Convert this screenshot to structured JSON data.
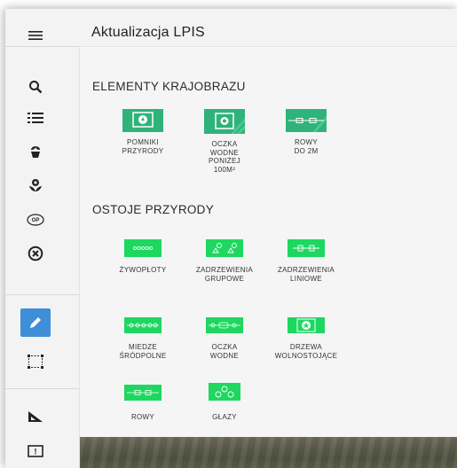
{
  "header": {
    "title": "Aktualizacja LPIS"
  },
  "sidebar": {
    "items": [
      {
        "icon": "menu-icon"
      },
      {
        "icon": "search-icon"
      },
      {
        "icon": "list-icon"
      },
      {
        "icon": "plant-icon"
      },
      {
        "icon": "flower-icon"
      },
      {
        "icon": "op-badge-icon",
        "label": "OP"
      },
      {
        "icon": "close-circle-icon"
      },
      {
        "icon": "pencil-icon",
        "active": true
      },
      {
        "icon": "select-area-icon"
      },
      {
        "icon": "measure-icon"
      },
      {
        "icon": "alert-icon",
        "label": "!"
      }
    ]
  },
  "sections": [
    {
      "title": "ELEMENTY KRAJOBRAZU",
      "items": [
        {
          "label": "POMNIKI\nPRZYRODY",
          "icon": "monument-icon"
        },
        {
          "label": "OCZKA\nWODNE\nPONIŻEJ\n100M²",
          "icon": "pond-small-icon"
        },
        {
          "label": "ROWY\nDO 2M",
          "icon": "ditch-small-icon"
        }
      ]
    },
    {
      "title": "OSTOJE PRZYRODY",
      "items": [
        {
          "label": "ŻYWOPŁOTY",
          "icon": "hedge-icon"
        },
        {
          "label": "ZADRZEWIENIA\nGRUPOWE",
          "icon": "tree-group-icon"
        },
        {
          "label": "ZADRZEWIENIA\nLINIOWE",
          "icon": "tree-line-icon"
        },
        {
          "label": "MIEDZE\nŚRÓDPOLNE",
          "icon": "balk-icon"
        },
        {
          "label": "OCZKA\nWODNE",
          "icon": "pond-icon"
        },
        {
          "label": "DRZEWA\nWOLNOSTOJĄCE",
          "icon": "solitary-tree-icon"
        },
        {
          "label": "ROWY",
          "icon": "ditch-icon"
        },
        {
          "label": "GŁAZY",
          "icon": "boulders-icon"
        }
      ]
    }
  ],
  "colors": {
    "accent": "#3e8fd8",
    "icon_green": "#1ed760",
    "icon_teal": "#2fb37a"
  }
}
